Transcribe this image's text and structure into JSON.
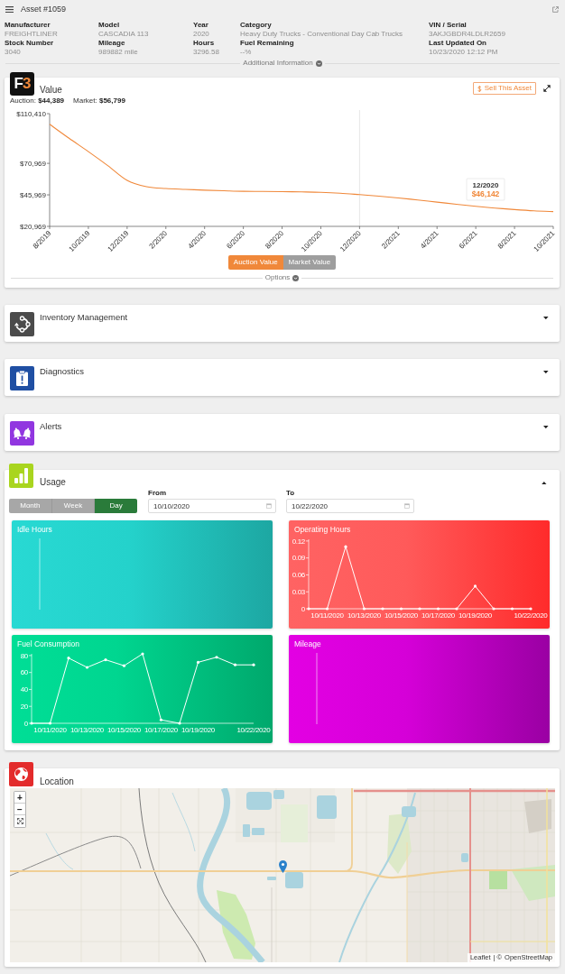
{
  "header": {
    "title": "Asset #1059"
  },
  "details": [
    {
      "label": "Manufacturer",
      "value": "FREIGHTLINER"
    },
    {
      "label": "Model",
      "value": "CASCADIA 113"
    },
    {
      "label": "Year",
      "value": "2020"
    },
    {
      "label": "Category",
      "value": "Heavy Duty Trucks - Conventional Day Cab Trucks"
    },
    {
      "label": "VIN / Serial",
      "value": "3AKJGBDR4LDLR2659"
    },
    {
      "label": "Stock Number",
      "value": "3040"
    },
    {
      "label": "Mileage",
      "value": "989882 mile"
    },
    {
      "label": "Hours",
      "value": "3296.58"
    },
    {
      "label": "Fuel Remaining",
      "value": "--%"
    },
    {
      "label": "Last Updated On",
      "value": "10/23/2020 12:12 PM"
    }
  ],
  "additional_info": {
    "label": "Additional Information",
    "expanded": false
  },
  "value": {
    "logo": "F3",
    "title": "Value",
    "summary": [
      "Auction: **$44,389**",
      "Market: **$56,799**"
    ],
    "sell_button": "Sell This Asset",
    "chart_data": {
      "type": "line",
      "categories": [
        "8/2019",
        null,
        "10/2019",
        null,
        "12/2019",
        null,
        "2/2020",
        null,
        "4/2020",
        null,
        "6/2020",
        null,
        "8/2020",
        null,
        "10/2020",
        null,
        "12/2020",
        null,
        "2/2021",
        null,
        "4/2021",
        null,
        "6/2021",
        null,
        "8/2021",
        null,
        "10/2021"
      ],
      "series": [
        {
          "name": "Auction Value",
          "color": "#f0883a",
          "values": [
            102000,
            90900,
            80300,
            69200,
            57500,
            52500,
            51000,
            50300,
            49700,
            49200,
            48800,
            48700,
            48500,
            48300,
            48000,
            47300,
            46142,
            44900,
            43500,
            41900,
            40200,
            38500,
            36900,
            35500,
            34300,
            33300,
            32700
          ]
        }
      ],
      "ylim": [
        20969,
        110410
      ],
      "yticks": [
        {
          "value": 110410,
          "label": "$110,410"
        },
        {
          "value": 70969,
          "label": "$70,969"
        },
        {
          "value": 45969,
          "label": "$45,969"
        },
        {
          "value": 20969,
          "label": "$20,969"
        }
      ],
      "ref_lines": [
        {
          "axis": "x",
          "value": "12/2020"
        }
      ],
      "annotations": [
        "12/2020",
        "$46,142"
      ]
    },
    "legend": [
      {
        "selected": true
      },
      {
        "label": "Market Value",
        "selected": false
      }
    ],
    "options": {
      "label": "Options",
      "expanded": false
    }
  },
  "sections": [
    {
      "title": "Inventory Management",
      "expanded": false
    },
    {
      "title": "Diagnostics",
      "expanded": false
    },
    {
      "title": "Alerts",
      "expanded": false
    }
  ],
  "usage": {
    "title": "Usage",
    "expanded": true,
    "periods": [
      {
        "label": "Month",
        "selected": false
      },
      {
        "label": "Week",
        "selected": false
      },
      {
        "label": "Day",
        "selected": true
      }
    ],
    "from": {
      "label": "From",
      "value": "10/10/2020"
    },
    "to": {
      "label": "To",
      "value": "10/22/2020"
    },
    "tiles": [
      {
        "title": "Idle Hours"
      },
      {
        "chart_data": {
          "type": "line",
          "title": "Operating Hours",
          "categories": [
            null,
            "10/11/2020",
            null,
            "10/13/2020",
            null,
            "10/15/2020",
            null,
            "10/17/2020",
            null,
            "10/19/2020",
            null,
            null,
            "10/22/2020"
          ],
          "series": [
            {
              "color": "#ffffff",
              "values": [
                0,
                0,
                0.11,
                0,
                0,
                0,
                0,
                0,
                0,
                0.04,
                0,
                0,
                0
              ]
            }
          ],
          "ylim": [
            0,
            0.123
          ],
          "yticks": [
            0,
            0.03,
            0.06,
            0.09,
            0.12
          ]
        }
      },
      {
        "chart_data": {
          "type": "line",
          "title": "Fuel Consumption",
          "categories": [
            null,
            "10/11/2020",
            null,
            "10/13/2020",
            null,
            "10/15/2020",
            null,
            "10/17/2020",
            null,
            "10/19/2020",
            null,
            null,
            "10/22/2020"
          ],
          "series": [
            {
              "color": "#ffffff",
              "values": [
                0,
                0,
                77,
                66,
                75,
                68,
                82,
                4,
                0,
                72,
                78,
                69,
                69
              ]
            }
          ],
          "ylim": [
            0,
            82
          ],
          "yticks": [
            0,
            20,
            40,
            60,
            80
          ]
        }
      },
      {
        "title": "Mileage"
      }
    ]
  },
  "location": {
    "title": "Location",
    "zoom_buttons": [
      "+",
      "−"
    ],
    "attribution": {
      "links": [
        "Leaflet",
        "OpenStreetMap"
      ],
      "separator": "| ©"
    }
  }
}
